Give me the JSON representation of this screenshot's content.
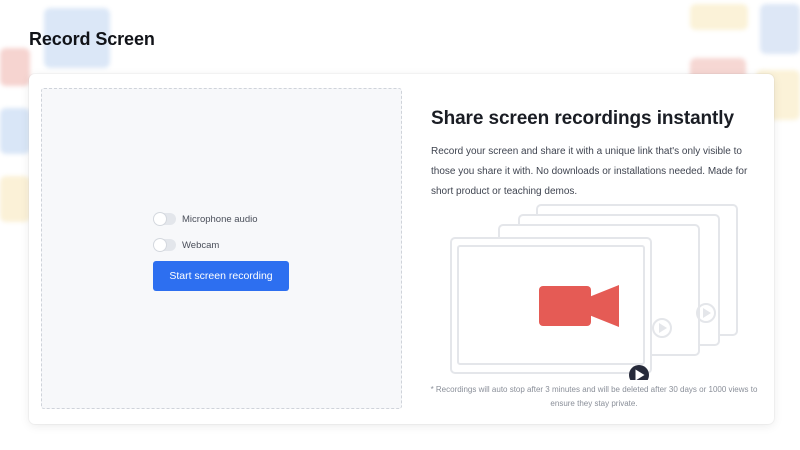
{
  "page": {
    "title": "Record Screen"
  },
  "recorder": {
    "microphone_label": "Microphone audio",
    "microphone_on": false,
    "webcam_label": "Webcam",
    "webcam_on": false,
    "start_label": "Start screen recording"
  },
  "info": {
    "title": "Share screen recordings instantly",
    "description": "Record your screen and share it with a unique link that's only visible to those you share it with. No downloads or installations needed. Made for short product or teaching demos.",
    "footnote": "* Recordings will auto stop after 3 minutes and will be deleted after 30 days or 1000 views to ensure they stay private."
  },
  "colors": {
    "accent": "#2d6ff0",
    "camera": "#e55b55",
    "play": "#262a3a"
  },
  "icons": {
    "camera": "video-camera-icon",
    "play": "play-icon"
  }
}
